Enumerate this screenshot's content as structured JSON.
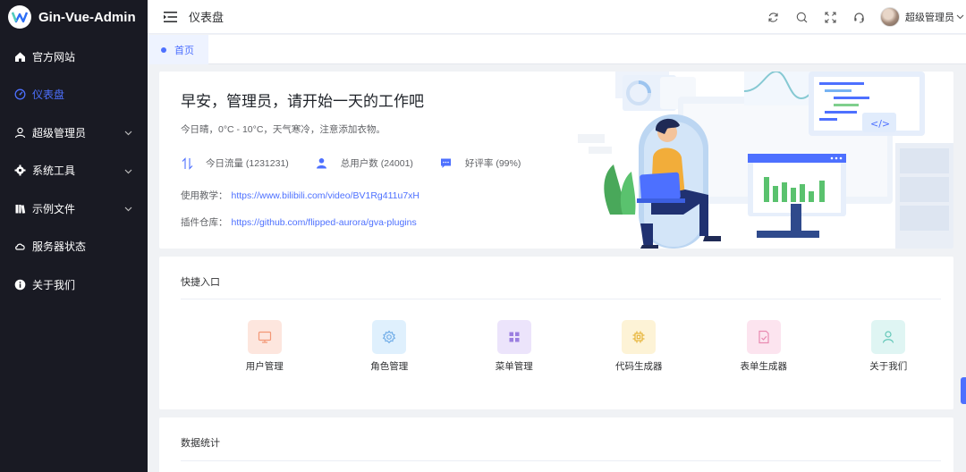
{
  "app": {
    "title": "Gin-Vue-Admin"
  },
  "sidebar": {
    "items": [
      {
        "label": "官方网站",
        "icon": "home-icon"
      },
      {
        "label": "仪表盘",
        "icon": "dashboard-icon",
        "active": true
      },
      {
        "label": "超级管理员",
        "icon": "user-icon",
        "expandable": true
      },
      {
        "label": "系统工具",
        "icon": "gear-icon",
        "expandable": true
      },
      {
        "label": "示例文件",
        "icon": "folder-icon",
        "expandable": true
      },
      {
        "label": "服务器状态",
        "icon": "cloud-icon"
      },
      {
        "label": "关于我们",
        "icon": "info-icon"
      }
    ]
  },
  "header": {
    "title": "仪表盘",
    "user_name": "超级管理员",
    "icons": [
      "refresh-icon",
      "search-icon",
      "fullscreen-icon",
      "headset-icon"
    ]
  },
  "tabs": [
    {
      "label": "首页",
      "active": true
    }
  ],
  "welcome": {
    "greeting": "早安，管理员，请开始一天的工作吧",
    "weather": "今日晴，0°C - 10°C，天气寒冷，注意添加衣物。",
    "stats": [
      {
        "label": "今日流量 (1231231)",
        "icon": "traffic-icon"
      },
      {
        "label": "总用户数 (24001)",
        "icon": "users-icon"
      },
      {
        "label": "好评率 (99%)",
        "icon": "comment-icon"
      }
    ],
    "tutorial_label": "使用教学：",
    "tutorial_url": "https://www.bilibili.com/video/BV1Rg411u7xH",
    "plugins_label": "插件仓库：",
    "plugins_url": "https://github.com/flipped-aurora/gva-plugins"
  },
  "quick": {
    "title": "快捷入口",
    "items": [
      {
        "label": "用户管理",
        "icon": "monitor-icon",
        "bg": "#fde6de",
        "fg": "#f39776"
      },
      {
        "label": "角色管理",
        "icon": "gear-icon",
        "bg": "#dff0fd",
        "fg": "#72aee8"
      },
      {
        "label": "菜单管理",
        "icon": "grid-icon",
        "bg": "#ece4fb",
        "fg": "#9b7ee0"
      },
      {
        "label": "代码生成器",
        "icon": "chip-icon",
        "bg": "#fdf3d6",
        "fg": "#e7b53b"
      },
      {
        "label": "表单生成器",
        "icon": "form-check-icon",
        "bg": "#fce4ef",
        "fg": "#e98ab1"
      },
      {
        "label": "关于我们",
        "icon": "user-icon",
        "bg": "#dff5f3",
        "fg": "#63c7b8"
      }
    ]
  },
  "datastat": {
    "title": "数据统计"
  },
  "colors": {
    "accent": "#4d70ff",
    "sidebar_bg": "#191a23"
  }
}
